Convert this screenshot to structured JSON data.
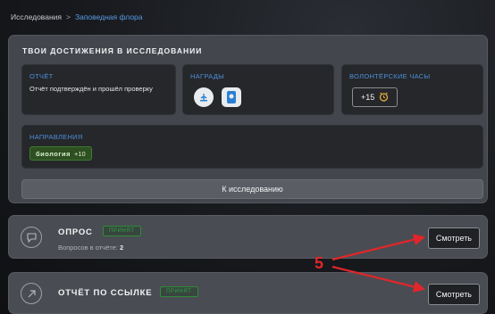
{
  "breadcrumb": {
    "root": "Исследования",
    "separator": ">",
    "current": "Заповедная флора"
  },
  "achievements": {
    "title": "Твои достижения в исследовании",
    "report": {
      "caption": "Отчёт",
      "text": "Отчёт подтверждён и прошёл проверку"
    },
    "awards": {
      "caption": "Награды",
      "icons": [
        "plant-badge-icon",
        "card-badge-icon"
      ]
    },
    "volunteer": {
      "caption": "Волонтёрские часы",
      "value": "+15",
      "icon": "alarm-clock-icon"
    },
    "directions": {
      "caption": "Направления",
      "tag_name": "биология",
      "tag_value": "+10"
    },
    "cta_label": "К исследованию"
  },
  "tasks": [
    {
      "title": "Опрос",
      "status": "принят",
      "sub_label": "Вопросов в отчёте:",
      "sub_value": "2",
      "button": "Смотреть",
      "icon": "chat-bubble-icon"
    },
    {
      "title": "Отчёт по ссылке",
      "status": "принят",
      "button": "Смотреть",
      "icon": "link-arrow-icon"
    }
  ],
  "annotation": {
    "number": "5",
    "color": "#e0262a"
  },
  "colors": {
    "accent_blue": "#4f8fd8",
    "status_green": "#2fa043",
    "tag_green": "#2e4f22"
  }
}
